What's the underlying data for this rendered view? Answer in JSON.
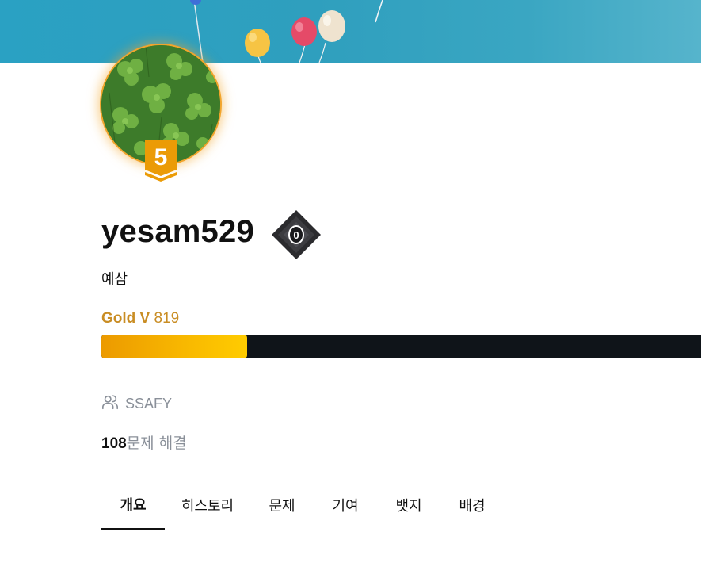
{
  "profile": {
    "username": "yesam529",
    "bio": "예삼",
    "tier_level": "5",
    "rank_badge_value": "0"
  },
  "rating": {
    "tier_name": "Gold V",
    "score": "819",
    "progress_fraction": 0.243,
    "colors": {
      "tier": "#c98d24",
      "bar_fill_start": "#ec9a00",
      "bar_fill_end": "#ffcc00",
      "bar_track": "#0f1419"
    }
  },
  "organization": {
    "icon": "users-icon",
    "name": "SSAFY"
  },
  "solved": {
    "count": "108",
    "label": "문제 해결"
  },
  "tabs": [
    {
      "label": "개요",
      "active": true
    },
    {
      "label": "히스토리",
      "active": false
    },
    {
      "label": "문제",
      "active": false
    },
    {
      "label": "기여",
      "active": false
    },
    {
      "label": "뱃지",
      "active": false
    },
    {
      "label": "배경",
      "active": false
    }
  ]
}
